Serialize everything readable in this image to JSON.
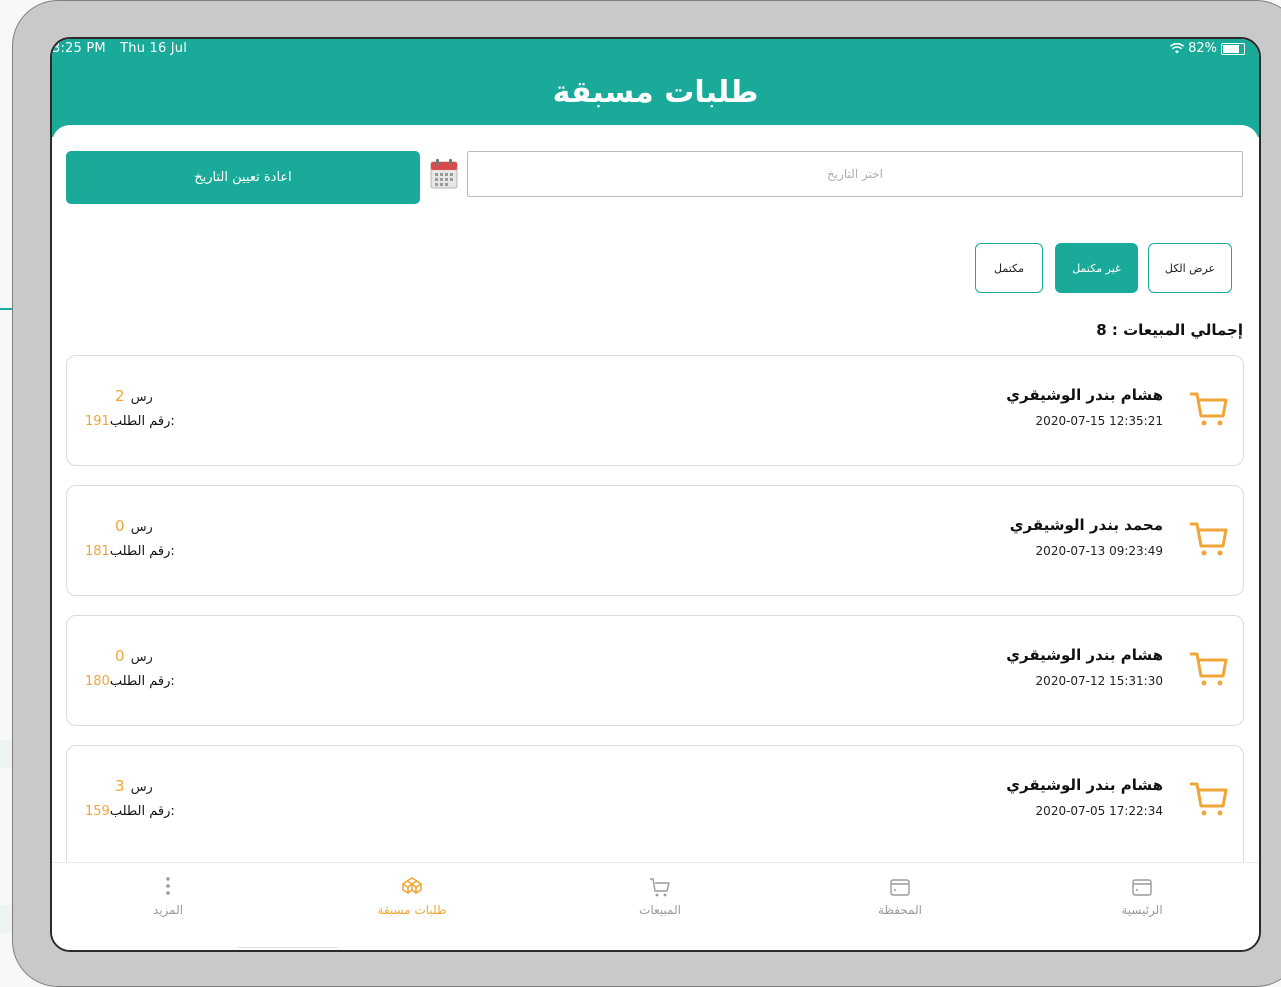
{
  "status_bar": {
    "time": "3:25 PM",
    "date": "Thu 16 Jul",
    "battery": "82%"
  },
  "header": {
    "title": "طلبات مسبقة"
  },
  "filters_bar": {
    "reset_button": "اعادة تعيين التاريخ",
    "date_placeholder": "اختر التاريخ"
  },
  "filters": {
    "complete": "مكتمل",
    "incomplete": "غير مكتمل",
    "all": "عرض الكل",
    "active": "incomplete"
  },
  "summary": {
    "total_label": "إجمالي المبيعات : 8"
  },
  "labels": {
    "currency": "رس",
    "order_number": "رقم الطلب:"
  },
  "orders": [
    {
      "customer": "هشام بندر الوشيقري",
      "datetime": "2020-07-15 12:35:21",
      "amount": "2",
      "order_no": "191"
    },
    {
      "customer": "محمد بندر الوشيقري",
      "datetime": "2020-07-13 09:23:49",
      "amount": "0",
      "order_no": "181"
    },
    {
      "customer": "هشام بندر الوشيقري",
      "datetime": "2020-07-12 15:31:30",
      "amount": "0",
      "order_no": "180"
    },
    {
      "customer": "هشام بندر الوشيقري",
      "datetime": "2020-07-05 17:22:34",
      "amount": "3",
      "order_no": "159"
    }
  ],
  "tabs": {
    "more": "المزيد",
    "preorders": "طلبات مسبقة",
    "sales": "المبيعات",
    "wallet": "المحفظة",
    "home": "الرئيسية"
  },
  "colors": {
    "primary": "#1aaa99",
    "accent": "#f0a637",
    "text": "#111111",
    "muted": "#9a9a9a"
  }
}
